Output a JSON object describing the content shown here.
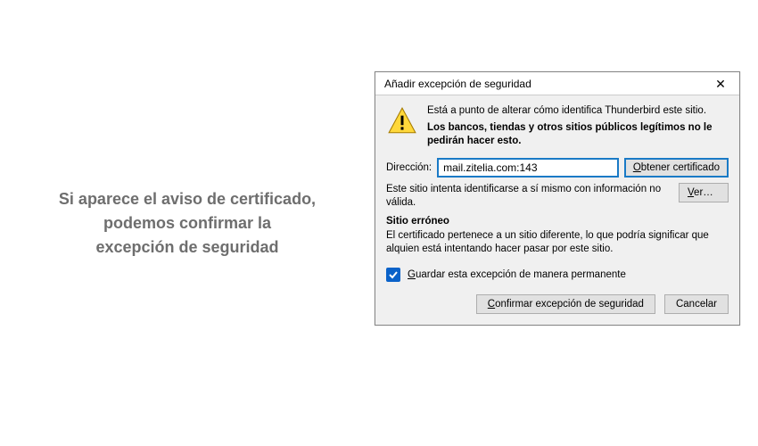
{
  "left": {
    "line1": "Si aparece el aviso de certificado,",
    "line2": "podemos confirmar la",
    "line3": "excepción de seguridad"
  },
  "dialog": {
    "title": "Añadir excepción de seguridad",
    "warn_line1": "Está a punto de alterar cómo identifica Thunderbird este sitio.",
    "warn_bold": "Los bancos, tiendas y otros sitios públicos legítimos no le pedirán hacer esto.",
    "addr_label": "Dirección:",
    "addr_value": "mail.zitelia.com:143",
    "get_cert_btn": "Obtener certificado",
    "invalid_info": "Este sitio intenta identificarse a sí mismo con información no válida.",
    "ver_btn": "Ver…",
    "wrong_site_hdr": "Sitio erróneo",
    "wrong_site_body": "El certificado pertenece a un sitio diferente, lo que podría significar que alquien está intentando hacer pasar por este sitio.",
    "save_perm": "Guardar esta excepción de manera permanente",
    "confirm_btn": "Confirmar excepción de seguridad",
    "cancel_btn": "Cancelar"
  }
}
